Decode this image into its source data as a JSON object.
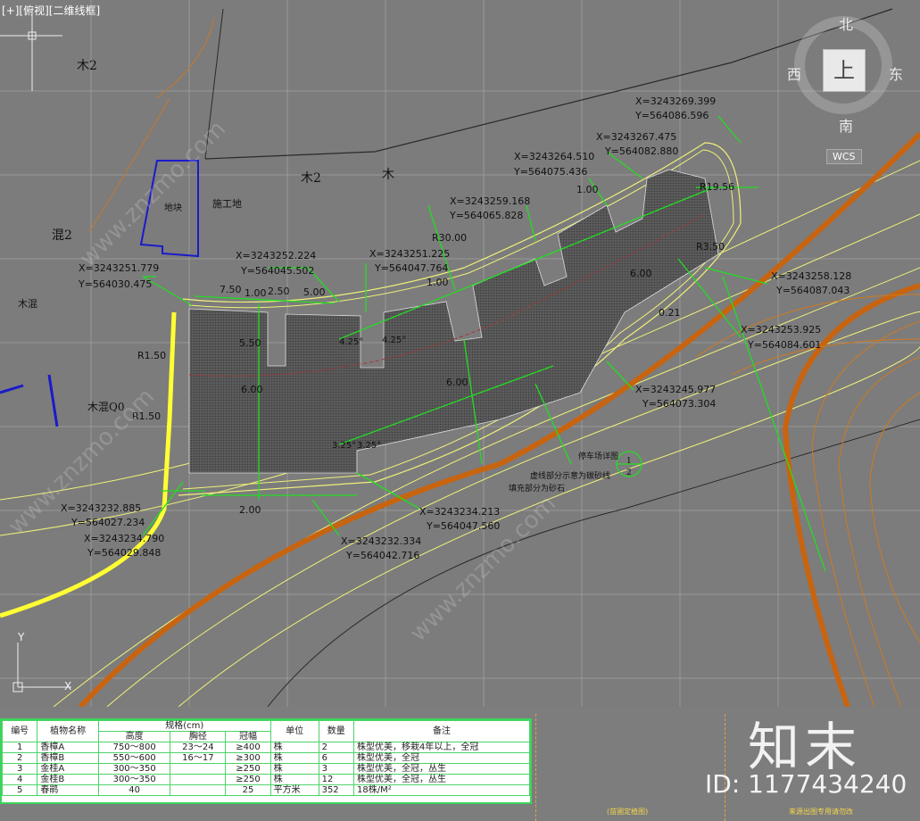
{
  "viewport": {
    "label": "[+][俯视][二维线框]",
    "compass": {
      "north": "北",
      "south": "南",
      "east": "东",
      "west": "西",
      "top": "上",
      "wcs": "WCS"
    }
  },
  "colors": {
    "background": "#7c7c7c",
    "dimension": "#22dd22",
    "road_edge": "#f0f07a",
    "road_center": "#c86410",
    "highlight": "#ffff33",
    "boundary": "#1a1acc",
    "contour": "#d07a1e",
    "grid": "#9a9a9a",
    "table_border": "#3cd35a"
  },
  "map_labels": {
    "tree_code_1": "木2",
    "tree_code_2": "木2",
    "tree_code_3": "木",
    "tree_code_4": "混2",
    "tree_code_5": "木混",
    "tree_code_6": "木混Q0",
    "construction": "施工地",
    "outline": "地块"
  },
  "coords": [
    {
      "x": "X=3243269.399",
      "y": "Y=564086.596"
    },
    {
      "x": "X=3243267.475",
      "y": "Y=564082.880"
    },
    {
      "x": "X=3243264.510",
      "y": "Y=564075.436"
    },
    {
      "x": "X=3243259.168",
      "y": "Y=564065.828"
    },
    {
      "x": "X=3243252.224",
      "y": "Y=564045.502"
    },
    {
      "x": "X=3243251.225",
      "y": "Y=564047.764"
    },
    {
      "x": "X=3243251.779",
      "y": "Y=564030.475"
    },
    {
      "x": "X=3243258.128",
      "y": "Y=564087.043"
    },
    {
      "x": "X=3243253.925",
      "y": "Y=564084.601"
    },
    {
      "x": "X=3243245.977",
      "y": "Y=564073.304"
    },
    {
      "x": "X=3243232.885",
      "y": "Y=564027.234"
    },
    {
      "x": "X=3243234.790",
      "y": "Y=564029.848"
    },
    {
      "x": "X=3243234.213",
      "y": "Y=564047.560"
    },
    {
      "x": "X=3243232.334",
      "y": "Y=564042.716"
    }
  ],
  "dims": {
    "d750": "7.50",
    "d250": "2.50",
    "d500": "5.00",
    "d100a": "1.00",
    "d100b": "1.00",
    "d100c": "1.00",
    "r30": "R30.00",
    "r19": "R19.56",
    "r150a": "R1.50",
    "r150b": "R1.50",
    "r350": "R3.50",
    "d550": "5.50",
    "d600a": "6.00",
    "d600b": "6.00",
    "d600c": "6.00",
    "d200": "2.00",
    "d021": "0.21",
    "d425a": "4.25°",
    "d425b": "4.25°",
    "d325a": "3.25°",
    "d325b": "3.25°"
  },
  "legend": {
    "title": "停车场详图",
    "num1": "1",
    "num2": "2",
    "line1": "虚线部分示意为碳砂线",
    "line2": "填充部分为砂石"
  },
  "table": {
    "headers": {
      "no": "编号",
      "name": "植物名称",
      "spec": "规格(cm)",
      "height": "高度",
      "dbh": "胸径",
      "crown": "冠幅",
      "unit": "单位",
      "qty": "数量",
      "note": "备注"
    },
    "rows": [
      {
        "no": "1",
        "name": "香樟A",
        "height": "750～800",
        "dbh": "23～24",
        "crown": "≥400",
        "unit": "株",
        "qty": "2",
        "note": "株型优美，移栽4年以上，全冠"
      },
      {
        "no": "2",
        "name": "香樟B",
        "height": "550～600",
        "dbh": "16～17",
        "crown": "≥300",
        "unit": "株",
        "qty": "6",
        "note": "株型优美，全冠"
      },
      {
        "no": "3",
        "name": "金桂A",
        "height": "300～350",
        "dbh": "",
        "crown": "≥250",
        "unit": "株",
        "qty": "3",
        "note": "株型优美，全冠，丛生"
      },
      {
        "no": "4",
        "name": "金桂B",
        "height": "300～350",
        "dbh": "",
        "crown": "≥250",
        "unit": "株",
        "qty": "12",
        "note": "株型优美，全冠，丛生"
      },
      {
        "no": "5",
        "name": "春鹃",
        "height": "40",
        "dbh": "",
        "crown": "25",
        "unit": "平方米",
        "qty": "352",
        "note": "18株/M²"
      }
    ]
  },
  "watermark": {
    "big": "知末",
    "id": "ID: 1177434240",
    "site": "www.znzmo.com"
  },
  "notes": {
    "left": "(苗圃定植图)",
    "right": "来源出图专用请勿改"
  }
}
